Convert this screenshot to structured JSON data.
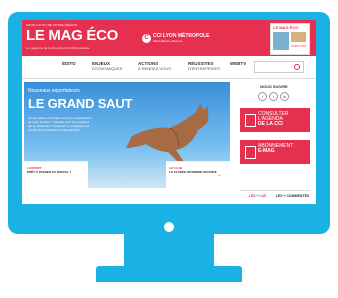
{
  "site": {
    "tagline": "DANS L'ACTU DE VOTRE RÉGION",
    "logo": "LE MAG ÉCO",
    "subtitle": "Le magazine de la Chambre CCI Métropolitaine",
    "cci_name": "CCI LYON MÉTROPOLE",
    "cci_sub": "Saint-Étienne Roanne",
    "magazine_badge": "LE MAG ÉCO",
    "magazine_date": "AVRIL 2017"
  },
  "nav": {
    "items": [
      {
        "title": "ÉDITO",
        "sub": ""
      },
      {
        "title": "ENJEUX",
        "sub": "ÉCONOMIQUES"
      },
      {
        "title": "ACTIONS",
        "sub": "& RENDEZ-VOUS"
      },
      {
        "title": "RÉUSSITES",
        "sub": "D'ENTREPRISES"
      },
      {
        "title": "WEBTV",
        "sub": ""
      }
    ]
  },
  "hero": {
    "kicker": "Nouveaux exportateurs",
    "title": "LE GRAND SAUT",
    "lines": [
      "Qui se cache-t-il derrière les primo-exportateurs",
      "de notre territoire ? Quelles sont les questions",
      "qui se posent-ils ? Comment s'y préparer pour",
      "réussir leur démarche à l'international ?"
    ]
  },
  "cards": [
    {
      "kicker": "L'EXPERT",
      "title": "PRÊT À PASSER AU DIGITAL ?"
    },
    {
      "kicker": "LE CLUB",
      "title": "LA CLASSE OUVRIÈRE PAYANTE"
    }
  ],
  "sidebar": {
    "follow": "NOUS SUIVRE",
    "agenda_line1": "CONSULTER",
    "agenda_line2": "L'AGENDA",
    "agenda_line3": "DE LA CCI",
    "abo_line1": "ABONNEMENT",
    "abo_line2": "E-MAG",
    "tab_read": "LES + LUS",
    "tab_comment": "LES + COMMENTÉS"
  },
  "colors": {
    "accent": "#e6304f",
    "device": "#1ab2e3"
  }
}
